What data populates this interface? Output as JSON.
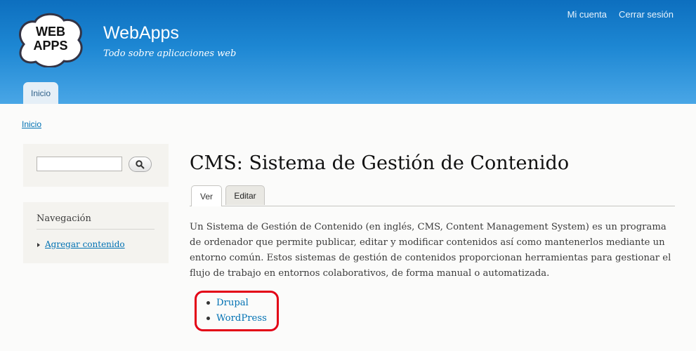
{
  "site": {
    "name": "WebApps",
    "slogan": "Todo sobre aplicaciones web",
    "logo_text": "WEB APPS"
  },
  "header": {
    "secondary_menu": [
      "Mi cuenta",
      "Cerrar sesión"
    ],
    "main_tabs": [
      "Inicio"
    ]
  },
  "breadcrumb": "Inicio",
  "sidebar": {
    "search_placeholder": "",
    "navigation_title": "Navegación",
    "navigation_items": [
      "Agregar contenido"
    ]
  },
  "main": {
    "title": "CMS: Sistema de Gestión de Contenido",
    "tabs": [
      "Ver",
      "Editar"
    ],
    "body": "Un Sistema de Gestión de Contenido (en inglés, CMS, Content Management System) es un programa de ordenador que permite publicar, editar y modificar contenidos así como mantenerlos mediante un entorno común. Estos sistemas de gestión de contenidos proporcionan herramientas para gestionar el flujo de trabajo en entornos colaborativos, de forma manual o automatizada.",
    "links": [
      "Drupal",
      "WordPress"
    ]
  },
  "colors": {
    "header": "#1d87d3",
    "link": "#0071b3",
    "highlight": "#e30016"
  }
}
